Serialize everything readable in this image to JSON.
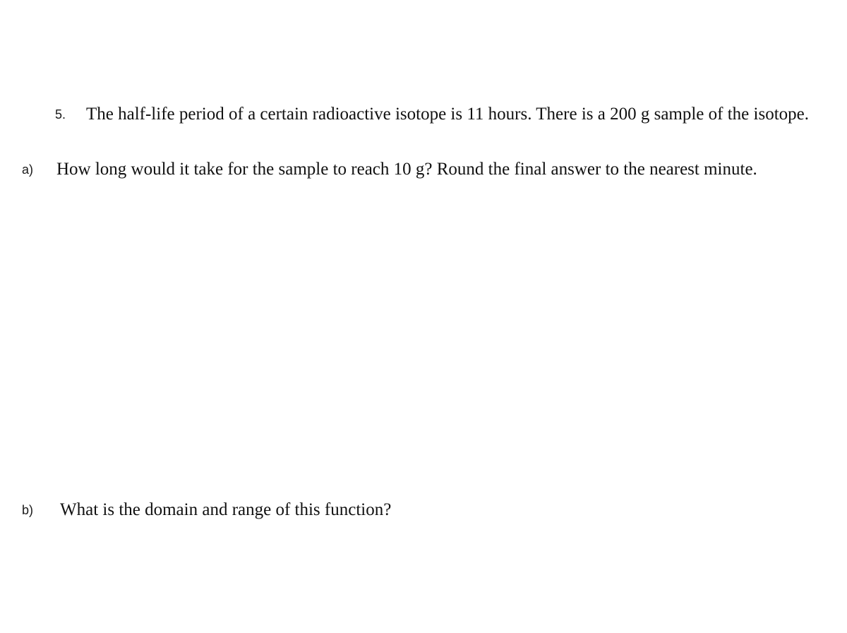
{
  "document": {
    "background_color": "#ffffff",
    "text_color": "#111111"
  },
  "questions": [
    {
      "marker": "5.",
      "text": "The half-life period of a certain radioactive isotope is 11 hours. There is a 200 g sample of the isotope."
    },
    {
      "marker": "a)",
      "text": "How long would it take for the sample to reach 10 g?  Round the final answer to the nearest minute."
    },
    {
      "marker": "b)",
      "text": "What is the domain and range of this function?"
    }
  ]
}
